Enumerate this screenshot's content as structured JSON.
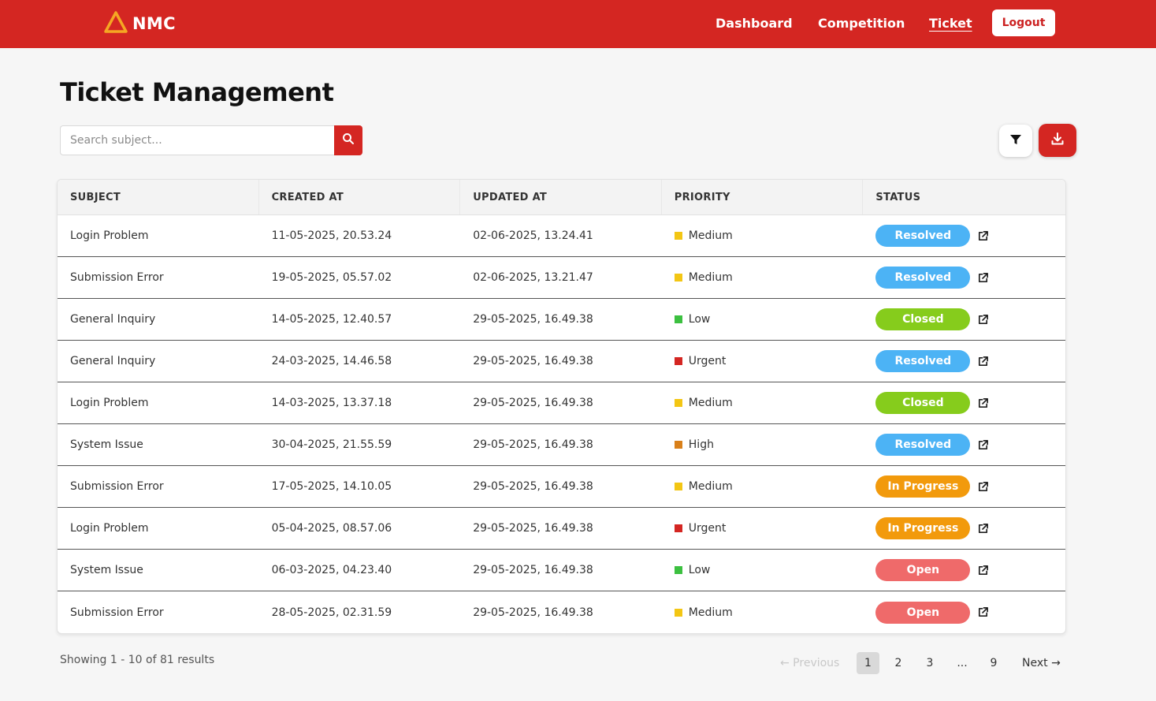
{
  "brand": {
    "name": "NMC"
  },
  "nav": {
    "links": [
      "Dashboard",
      "Competition",
      "Ticket"
    ],
    "active": "Ticket",
    "logout": "Logout"
  },
  "page": {
    "title": "Ticket Management"
  },
  "search": {
    "placeholder": "Search subject..."
  },
  "table": {
    "headers": [
      "SUBJECT",
      "CREATED AT",
      "UPDATED AT",
      "PRIORITY",
      "STATUS"
    ],
    "rows": [
      {
        "subject": "Login Problem",
        "created": "11-05-2025, 20.53.24",
        "updated": "02-06-2025, 13.24.41",
        "priority": "Medium",
        "status": "Resolved"
      },
      {
        "subject": "Submission Error",
        "created": "19-05-2025, 05.57.02",
        "updated": "02-06-2025, 13.21.47",
        "priority": "Medium",
        "status": "Resolved"
      },
      {
        "subject": "General Inquiry",
        "created": "14-05-2025, 12.40.57",
        "updated": "29-05-2025, 16.49.38",
        "priority": "Low",
        "status": "Closed"
      },
      {
        "subject": "General Inquiry",
        "created": "24-03-2025, 14.46.58",
        "updated": "29-05-2025, 16.49.38",
        "priority": "Urgent",
        "status": "Resolved"
      },
      {
        "subject": "Login Problem",
        "created": "14-03-2025, 13.37.18",
        "updated": "29-05-2025, 16.49.38",
        "priority": "Medium",
        "status": "Closed"
      },
      {
        "subject": "System Issue",
        "created": "30-04-2025, 21.55.59",
        "updated": "29-05-2025, 16.49.38",
        "priority": "High",
        "status": "Resolved"
      },
      {
        "subject": "Submission Error",
        "created": "17-05-2025, 14.10.05",
        "updated": "29-05-2025, 16.49.38",
        "priority": "Medium",
        "status": "In Progress"
      },
      {
        "subject": "Login Problem",
        "created": "05-04-2025, 08.57.06",
        "updated": "29-05-2025, 16.49.38",
        "priority": "Urgent",
        "status": "In Progress"
      },
      {
        "subject": "System Issue",
        "created": "06-03-2025, 04.23.40",
        "updated": "29-05-2025, 16.49.38",
        "priority": "Low",
        "status": "Open"
      },
      {
        "subject": "Submission Error",
        "created": "28-05-2025, 02.31.59",
        "updated": "29-05-2025, 16.49.38",
        "priority": "Medium",
        "status": "Open"
      }
    ]
  },
  "colors": {
    "brand_red": "#d42622",
    "priority": {
      "Low": "#3cc040",
      "Medium": "#f3c614",
      "High": "#d9801a",
      "Urgent": "#d42622"
    },
    "status": {
      "Resolved": "#4cb3f5",
      "Closed": "#86cc1c",
      "In Progress": "#f29a0c",
      "Open": "#ef6a6a"
    }
  },
  "icons": {
    "search": "search-icon",
    "filter": "filter-icon",
    "download": "download-icon",
    "external": "external-link-icon",
    "logo": "triangle-logo-icon"
  },
  "footer": {
    "results": "Showing 1 - 10 of 81 results"
  },
  "pagination": {
    "prev": "← Previous",
    "pages": [
      "1",
      "2",
      "3",
      "...",
      "9"
    ],
    "current": "1",
    "next": "Next →"
  }
}
